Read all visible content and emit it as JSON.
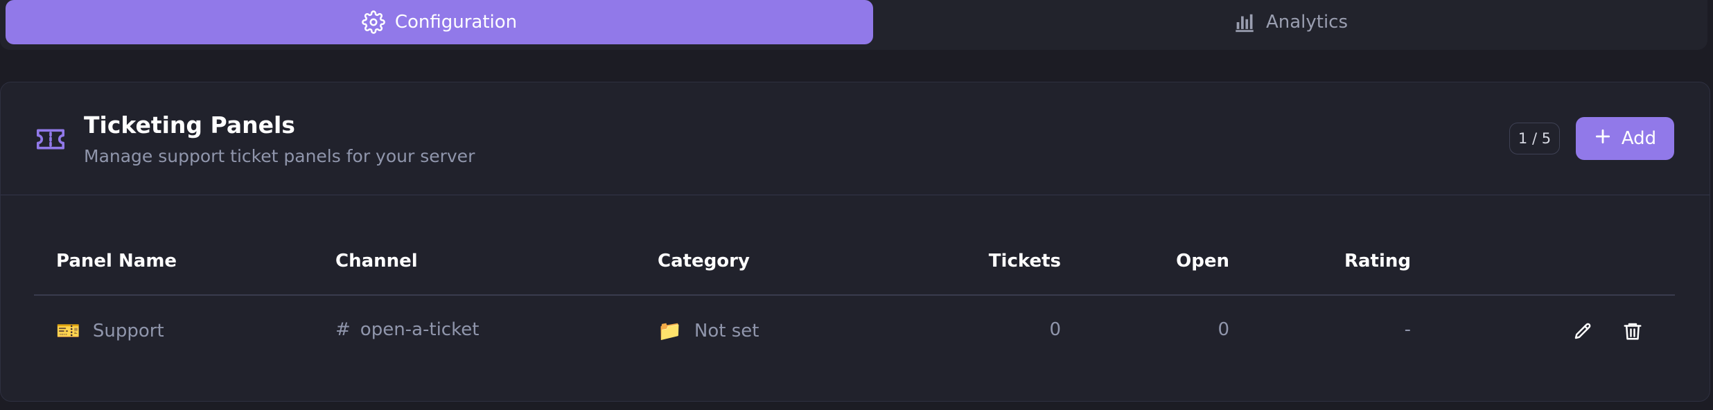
{
  "tabs": [
    {
      "label": "Configuration",
      "icon": "gear-icon",
      "active": true
    },
    {
      "label": "Analytics",
      "icon": "bar-chart-icon",
      "active": false
    }
  ],
  "panel": {
    "title": "Ticketing Panels",
    "subtitle": "Manage support ticket panels for your server",
    "icon": "ticket-icon",
    "count": "1 / 5",
    "add_label": "Add"
  },
  "table": {
    "columns": [
      "Panel Name",
      "Channel",
      "Category",
      "Tickets",
      "Open",
      "Rating"
    ],
    "rows": [
      {
        "emoji": "🎫",
        "name": "Support",
        "channel_prefix": "#",
        "channel": "open-a-ticket",
        "category_emoji": "📁",
        "category": "Not set",
        "tickets": "0",
        "open": "0",
        "rating": "-"
      }
    ]
  },
  "colors": {
    "accent": "#9179e9",
    "background": "#1c1c24",
    "card": "#21222c",
    "muted_text": "#9096ac"
  }
}
